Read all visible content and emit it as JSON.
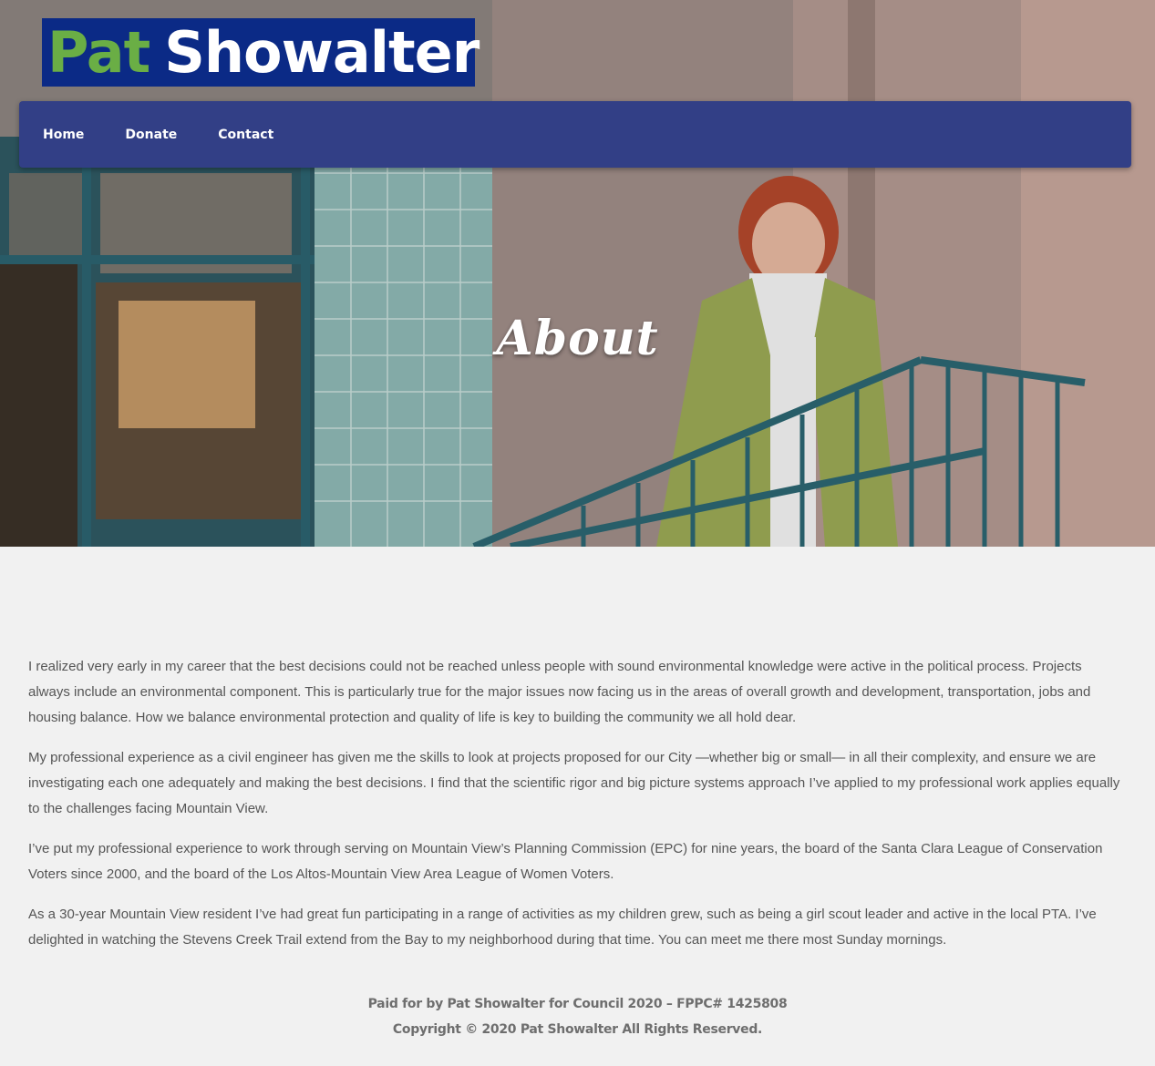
{
  "brand": {
    "first_name": "Pat",
    "last_name": "Showalter",
    "colors": {
      "logo_bg": "#0b2a86",
      "first_name": "#6aae45",
      "last_name": "#ffffff"
    }
  },
  "nav": {
    "items": [
      {
        "label": "Home"
      },
      {
        "label": "Donate"
      },
      {
        "label": "Contact"
      }
    ],
    "color": "#323f86"
  },
  "hero": {
    "title": "About",
    "image_alt_icon": "portrait-photo"
  },
  "content": {
    "paragraphs": [
      "I realized very early in my career that the best decisions could not be reached unless people with sound environmental knowledge were active in the political process. Projects always include an environmental component. This is particularly true for the major issues now facing us in the areas of overall growth and development, transportation, jobs and housing balance. How we balance environmental protection and quality of life is key to building the community we all hold dear.",
      "My professional experience as a civil engineer has given me the skills to look at projects proposed for our City —whether big or small— in all their complexity, and ensure we are investigating each one adequately and making the best decisions. I find that the scientific rigor and big picture systems approach I’ve applied to my professional work applies equally to the challenges facing Mountain View.",
      "I’ve put my professional experience to work through serving on Mountain View’s Planning Commission (EPC) for nine years, the board of the Santa Clara League of Conservation Voters since 2000, and the board of the Los Altos-Mountain View Area League of Women Voters.",
      "As a 30-year Mountain View resident I’ve had great fun participating in a range of activities as my children grew, such as being a girl scout leader and active in the local PTA. I’ve delighted in watching the Stevens Creek Trail extend from the Bay to my neighborhood during that time. You can meet me there most Sunday mornings."
    ]
  },
  "footer": {
    "paid_for": "Paid for by Pat Showalter for Council 2020 – FPPC# 1425808",
    "copyright": "Copyright © 2020 Pat Showalter All Rights Reserved."
  }
}
